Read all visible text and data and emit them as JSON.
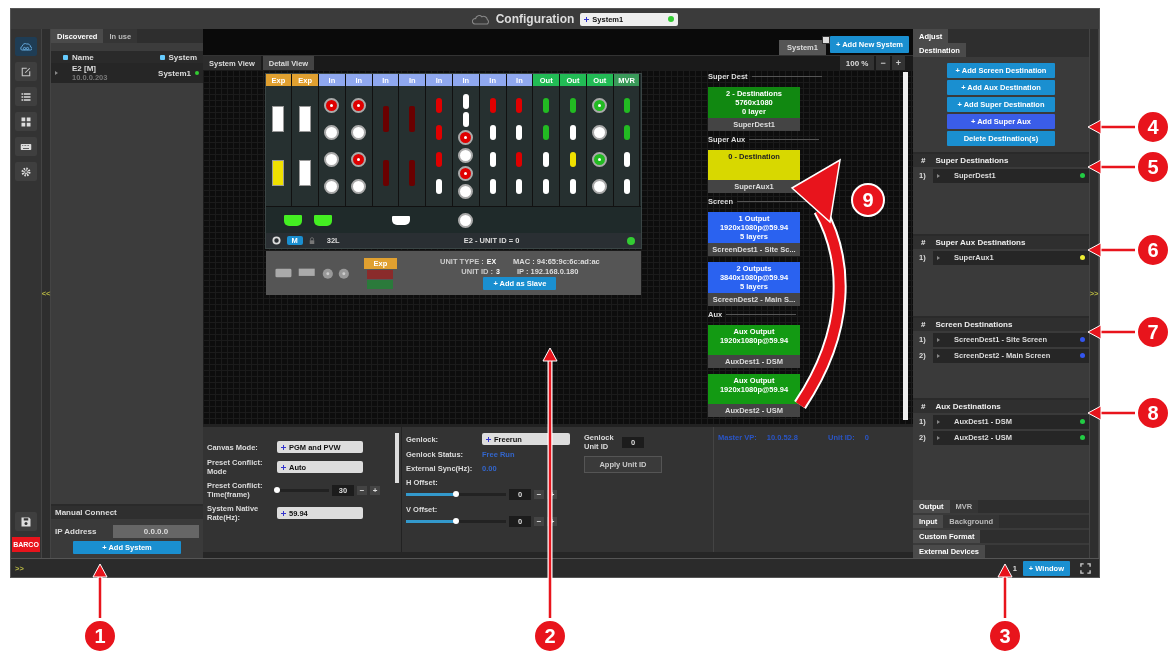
{
  "title_bar": {
    "title": "Configuration",
    "system_select": "System1",
    "system_online": true
  },
  "rail": {
    "items": [
      {
        "kind": "cloud",
        "selected": true
      },
      {
        "kind": "edit",
        "selected": false
      },
      {
        "kind": "list",
        "selected": false
      },
      {
        "kind": "grid",
        "selected": false
      },
      {
        "kind": "keyboard",
        "selected": false
      },
      {
        "kind": "gear",
        "selected": false
      }
    ],
    "footer_items": [
      {
        "kind": "save"
      }
    ],
    "logo": "BARCO"
  },
  "collapse_handles": {
    "left": "<<",
    "right": ">>",
    "status": ">>"
  },
  "left_panel": {
    "tabs": [
      {
        "label": "Discovered",
        "selected": true
      },
      {
        "label": "In use",
        "selected": false
      }
    ],
    "columns": [
      "Name",
      "System"
    ],
    "rows": [
      {
        "name": "E2 [M]",
        "address": "10.0.0.203",
        "system": "System1",
        "online": true
      }
    ],
    "manual_connect": {
      "title": "Manual Connect",
      "ip_label": "IP Address",
      "ip_value": "0.0.0.0",
      "button": "+ Add System"
    }
  },
  "center": {
    "system_tab": "System1",
    "add_system": "+ Add New System",
    "view_tabs": [
      {
        "label": "System View",
        "selected": false
      },
      {
        "label": "Detail View",
        "selected": true
      }
    ],
    "zoom": "100 %",
    "zoom_out": "−",
    "zoom_in": "+",
    "device": {
      "slots": [
        {
          "kind": "exp",
          "label": "Exp",
          "ports": [
            {
              "kind": "sfp",
              "color": "#ffffff"
            },
            {
              "kind": "sfp",
              "color": "#f0e000"
            }
          ]
        },
        {
          "kind": "exp",
          "label": "Exp",
          "ports": [
            {
              "kind": "sfp",
              "color": "#ffffff"
            },
            {
              "kind": "sfp",
              "color": "#ffffff"
            }
          ]
        },
        {
          "kind": "in",
          "label": "In",
          "ports": [
            {
              "kind": "bnc",
              "color": "#e00000"
            },
            {
              "kind": "bnc",
              "color": "#ffffff"
            },
            {
              "kind": "bnc",
              "color": "#ffffff"
            },
            {
              "kind": "bnc",
              "color": "#ffffff"
            }
          ]
        },
        {
          "kind": "in",
          "label": "In",
          "ports": [
            {
              "kind": "bnc",
              "color": "#e00000"
            },
            {
              "kind": "bnc",
              "color": "#ffffff"
            },
            {
              "kind": "bnc",
              "color": "#e00000"
            },
            {
              "kind": "bnc",
              "color": "#ffffff"
            }
          ]
        },
        {
          "kind": "in",
          "label": "In",
          "ports": [
            {
              "kind": "dp",
              "color": "#6a0000"
            },
            {
              "kind": "dp",
              "color": "#6a0000"
            }
          ]
        },
        {
          "kind": "in",
          "label": "In",
          "ports": [
            {
              "kind": "dp",
              "color": "#6a0000"
            },
            {
              "kind": "dp",
              "color": "#6a0000"
            }
          ]
        },
        {
          "kind": "in",
          "label": "In",
          "ports": [
            {
              "kind": "hdmi",
              "color": "#e00000"
            },
            {
              "kind": "hdmi",
              "color": "#e00000"
            },
            {
              "kind": "hdmi",
              "color": "#e00000"
            },
            {
              "kind": "hdmi",
              "color": "#ffffff"
            }
          ]
        },
        {
          "kind": "in",
          "label": "In",
          "ports": [
            {
              "kind": "hdmi",
              "color": "#ffffff"
            },
            {
              "kind": "hdmi",
              "color": "#ffffff"
            },
            {
              "kind": "bnc",
              "color": "#e00000"
            },
            {
              "kind": "bnc",
              "color": "#ffffff"
            },
            {
              "kind": "bnc",
              "color": "#e00000"
            },
            {
              "kind": "bnc",
              "color": "#ffffff"
            }
          ]
        },
        {
          "kind": "in",
          "label": "In",
          "ports": [
            {
              "kind": "hdmi",
              "color": "#e00000"
            },
            {
              "kind": "hdmi",
              "color": "#ffffff"
            },
            {
              "kind": "hdmi",
              "color": "#ffffff"
            },
            {
              "kind": "hdmi",
              "color": "#ffffff"
            }
          ]
        },
        {
          "kind": "in",
          "label": "In",
          "ports": [
            {
              "kind": "hdmi",
              "color": "#e00000"
            },
            {
              "kind": "hdmi",
              "color": "#ffffff"
            },
            {
              "kind": "hdmi",
              "color": "#e00000"
            },
            {
              "kind": "hdmi",
              "color": "#ffffff"
            }
          ]
        },
        {
          "kind": "out",
          "label": "Out",
          "ports": [
            {
              "kind": "hdmi",
              "color": "#22bb22"
            },
            {
              "kind": "hdmi",
              "color": "#22bb22"
            },
            {
              "kind": "hdmi",
              "color": "#ffffff"
            },
            {
              "kind": "hdmi",
              "color": "#ffffff"
            }
          ]
        },
        {
          "kind": "out",
          "label": "Out",
          "ports": [
            {
              "kind": "hdmi",
              "color": "#22bb22"
            },
            {
              "kind": "hdmi",
              "color": "#ffffff"
            },
            {
              "kind": "hdmi",
              "color": "#f0e000"
            },
            {
              "kind": "hdmi",
              "color": "#ffffff"
            }
          ]
        },
        {
          "kind": "out",
          "label": "Out",
          "ports": [
            {
              "kind": "bnc",
              "color": "#22bb22"
            },
            {
              "kind": "bnc",
              "color": "#ffffff"
            },
            {
              "kind": "bnc",
              "color": "#22bb22"
            },
            {
              "kind": "bnc",
              "color": "#ffffff"
            }
          ]
        },
        {
          "kind": "mvr",
          "label": "MVR",
          "ports": [
            {
              "kind": "hdmi",
              "color": "#22bb22"
            },
            {
              "kind": "hdmi",
              "color": "#22bb22"
            },
            {
              "kind": "hdmi",
              "color": "#ffffff"
            },
            {
              "kind": "hdmi",
              "color": "#ffffff"
            }
          ]
        }
      ],
      "rear_ports": [
        {
          "kind": "terminal",
          "color": "#44ee22"
        },
        {
          "kind": "terminal",
          "color": "#44ee22"
        },
        {
          "kind": "ethernet",
          "color": "#ffffff"
        },
        {
          "kind": "bnc",
          "color": "#ffffff"
        }
      ],
      "status": {
        "mode": "M",
        "connector": "32L",
        "unit": "E2 - UNIT ID = 0",
        "online": true
      },
      "expansion": {
        "label": "Exp",
        "unit_type_label": "UNIT TYPE :",
        "unit_type": "EX",
        "mac": "MAC : 94:65:9c:6c:ad:ac",
        "unit_id_label": "UNIT ID :",
        "unit_id": "3",
        "ip": "IP : 192.168.0.180",
        "button": "+ Add as Slave"
      }
    },
    "destinations": [
      {
        "kind": "super_dest",
        "title": "Super Dest",
        "cards": [
          {
            "lines": [
              "2 - Destinations",
              "5760x1080",
              "0 layer"
            ],
            "name": "SuperDest1"
          }
        ]
      },
      {
        "kind": "super_aux",
        "title": "Super Aux",
        "cards": [
          {
            "lines": [
              "0 - Destination"
            ],
            "name": "SuperAux1"
          }
        ]
      },
      {
        "kind": "screen",
        "title": "Screen",
        "cards": [
          {
            "lines": [
              "1 Output",
              "1920x1080p@59.94",
              "5 layers"
            ],
            "name": "ScreenDest1 - Site Sc..."
          },
          {
            "lines": [
              "2 Outputs",
              "3840x1080p@59.94",
              "5 layers"
            ],
            "name": "ScreenDest2 - Main S..."
          }
        ]
      },
      {
        "kind": "aux",
        "title": "Aux",
        "cards": [
          {
            "lines": [
              "Aux Output",
              "1920x1080p@59.94"
            ],
            "name": "AuxDest1 - DSM"
          },
          {
            "lines": [
              "Aux Output",
              "1920x1080p@59.94"
            ],
            "name": "AuxDest2 - USM"
          }
        ]
      }
    ],
    "settings": {
      "system": [
        {
          "kind": "select",
          "label": "Canvas Mode:",
          "value": "PGM and PVW"
        },
        {
          "kind": "select",
          "label": "Preset Conflict: Mode",
          "value": "Auto"
        },
        {
          "kind": "slider",
          "label": "Preset Conflict: Time(frame)",
          "level": 0.0,
          "value": "30",
          "minus": "−",
          "plus": "+"
        },
        {
          "kind": "select",
          "label": "System Native Rate(Hz):",
          "value": "59.94"
        }
      ],
      "genlock": [
        {
          "kind": "select",
          "label": "Genlock:",
          "value": "Freerun"
        },
        {
          "kind": "status",
          "label": "Genlock Status:",
          "value": "Free Run"
        },
        {
          "kind": "status",
          "label": "External Sync(Hz):",
          "value": "0.00"
        },
        {
          "kind": "slider",
          "label": "H Offset:",
          "level": 0.5,
          "value": "0",
          "minus": "−",
          "plus": "+"
        },
        {
          "kind": "slider",
          "label": "V Offset:",
          "level": 0.5,
          "value": "0",
          "minus": "−",
          "plus": "+"
        }
      ],
      "unit": {
        "label": "Genlock Unit ID",
        "value": "0",
        "button": "Apply Unit ID"
      },
      "master": {
        "vp_label": "Master VP:",
        "vp_value": "10.0.52.8",
        "unit_label": "Unit ID:",
        "unit_value": "0"
      }
    }
  },
  "right_panel": {
    "tabs": [
      {
        "label": "Adjust",
        "selected": true
      }
    ],
    "subtabs": [
      {
        "label": "Destination",
        "selected": true
      }
    ],
    "buttons": [
      {
        "label": "+ Add Screen Destination",
        "selected": false
      },
      {
        "label": "+ Add Aux Destination",
        "selected": false
      },
      {
        "label": "+ Add Super Destination",
        "selected": false
      },
      {
        "label": "+ Add Super Aux",
        "selected": true
      },
      {
        "label": "Delete Destination(s)",
        "selected": false
      }
    ],
    "lists": [
      {
        "mark": "#",
        "title": "Super Destinations",
        "items": [
          {
            "index": "1)",
            "name": "SuperDest1",
            "color": "#22cc44"
          }
        ]
      },
      {
        "mark": "#",
        "title": "Super Aux Destinations",
        "items": [
          {
            "index": "1)",
            "name": "SuperAux1",
            "color": "#eeee33"
          }
        ]
      },
      {
        "mark": "#",
        "title": "Screen Destinations",
        "items": [
          {
            "index": "1)",
            "name": "ScreenDest1 - Site Screen",
            "color": "#3355ee"
          },
          {
            "index": "2)",
            "name": "ScreenDest2 - Main Screen",
            "color": "#3355ee"
          }
        ]
      },
      {
        "mark": "#",
        "title": "Aux Destinations",
        "items": [
          {
            "index": "1)",
            "name": "AuxDest1 - DSM",
            "color": "#22cc44"
          },
          {
            "index": "2)",
            "name": "AuxDest2 - USM",
            "color": "#22cc44"
          }
        ]
      }
    ],
    "bottom_tabs": [
      [
        {
          "label": "Output",
          "selected": true
        },
        {
          "label": "MVR",
          "selected": false
        }
      ],
      [
        {
          "label": "Input",
          "selected": true
        },
        {
          "label": "Background",
          "selected": false
        }
      ],
      [
        {
          "label": "Custom Format",
          "selected": true
        }
      ],
      [
        {
          "label": "External Devices",
          "selected": true
        }
      ]
    ]
  },
  "status_bar": {
    "page": "1",
    "window_button": "+ Window"
  },
  "callouts": [
    {
      "label": "1"
    },
    {
      "label": "2"
    },
    {
      "label": "3"
    },
    {
      "label": "4"
    },
    {
      "label": "5"
    },
    {
      "label": "6"
    },
    {
      "label": "7"
    },
    {
      "label": "8"
    },
    {
      "label": "9"
    }
  ]
}
